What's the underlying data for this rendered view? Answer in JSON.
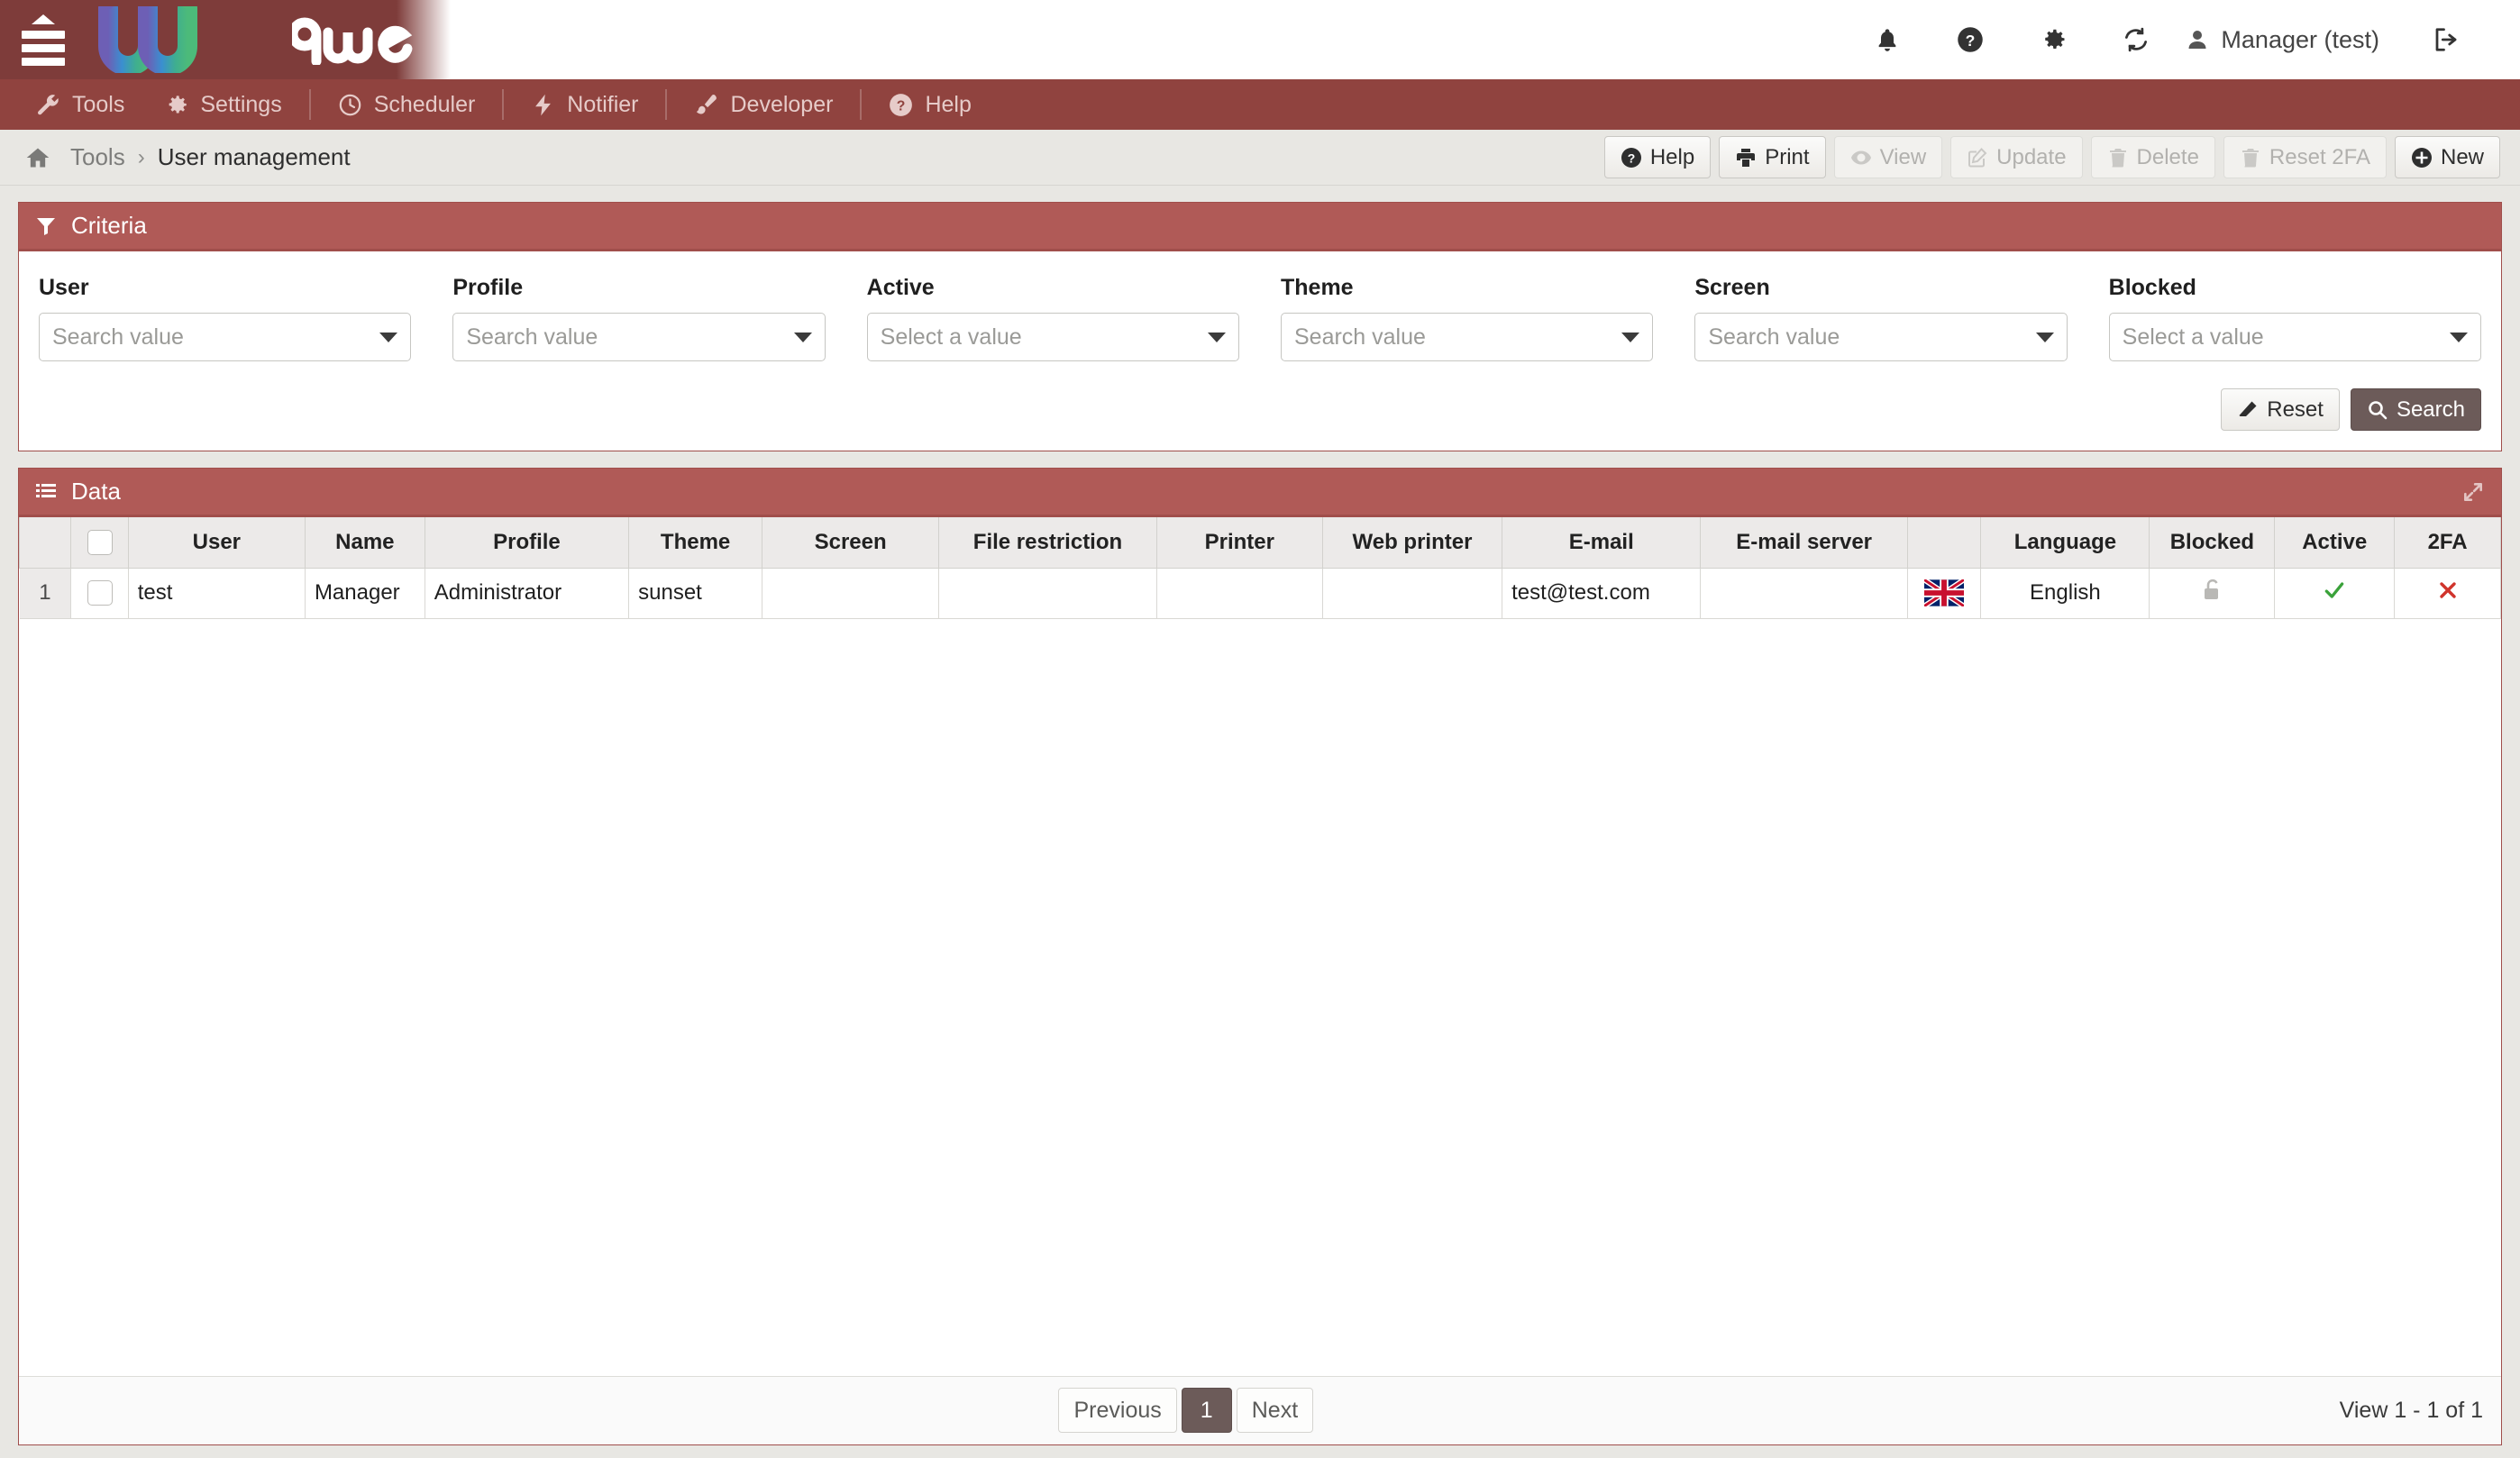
{
  "brand": {
    "name": "awe",
    "logo_mark": "W"
  },
  "topbar": {
    "menu_toggle": "menu-toggle",
    "icons": [
      "bell-icon",
      "question-circle-icon",
      "gear-icon",
      "refresh-icon"
    ],
    "user_label": "Manager (test)",
    "logout": "logout-icon"
  },
  "menubar": {
    "items": [
      {
        "label": "Tools",
        "icon": "wrench-icon"
      },
      {
        "label": "Settings",
        "icon": "gear-icon"
      },
      {
        "label": "Scheduler",
        "icon": "clock-icon"
      },
      {
        "label": "Notifier",
        "icon": "bolt-icon"
      },
      {
        "label": "Developer",
        "icon": "paintbrush-icon"
      },
      {
        "label": "Help",
        "icon": "question-circle-icon"
      }
    ]
  },
  "breadcrumb": {
    "home_icon": "home-icon",
    "parent": "Tools",
    "separator": "›",
    "current": "User management"
  },
  "actions": [
    {
      "label": "Help",
      "icon": "question-circle-icon",
      "disabled": false
    },
    {
      "label": "Print",
      "icon": "printer-icon",
      "disabled": false
    },
    {
      "label": "View",
      "icon": "eye-icon",
      "disabled": true
    },
    {
      "label": "Update",
      "icon": "pencil-square-icon",
      "disabled": true
    },
    {
      "label": "Delete",
      "icon": "trash-icon",
      "disabled": true
    },
    {
      "label": "Reset 2FA",
      "icon": "trash-icon",
      "disabled": true
    },
    {
      "label": "New",
      "icon": "plus-circle-icon",
      "disabled": false
    }
  ],
  "criteria": {
    "title": "Criteria",
    "icon": "filter-icon",
    "fields": [
      {
        "label": "User",
        "placeholder": "Search value"
      },
      {
        "label": "Profile",
        "placeholder": "Search value"
      },
      {
        "label": "Active",
        "placeholder": "Select a value"
      },
      {
        "label": "Theme",
        "placeholder": "Search value"
      },
      {
        "label": "Screen",
        "placeholder": "Search value"
      },
      {
        "label": "Blocked",
        "placeholder": "Select a value"
      }
    ],
    "reset_label": "Reset",
    "reset_icon": "eraser-icon",
    "search_label": "Search",
    "search_icon": "magnifier-icon"
  },
  "data_panel": {
    "title": "Data",
    "icon": "list-icon",
    "expand_icon": "expand-arrows-icon",
    "columns": [
      "",
      "",
      "User",
      "Name",
      "Profile",
      "Theme",
      "Screen",
      "File restriction",
      "Printer",
      "Web printer",
      "E-mail",
      "E-mail server",
      "",
      "Language",
      "Blocked",
      "Active",
      "2FA"
    ],
    "rows": [
      {
        "num": "1",
        "user": "test",
        "name": "Manager",
        "profile": "Administrator",
        "theme": "sunset",
        "screen": "",
        "file_restriction": "",
        "printer": "",
        "web_printer": "",
        "email": "test@test.com",
        "email_server": "",
        "flag": "uk-flag-icon",
        "language": "English",
        "blocked": "unlock-icon",
        "active": "check-icon",
        "twofa": "cross-icon"
      }
    ],
    "pagination": {
      "previous": "Previous",
      "pages": [
        "1"
      ],
      "current_page": "1",
      "next": "Next",
      "view_count": "View 1 - 1 of 1"
    }
  },
  "colors": {
    "topbar": "#7e3c3a",
    "menubar": "#90433f",
    "panel_header": "#b05a57",
    "panel_border": "#a04e4b",
    "page_bg": "#e8e7e3",
    "primary_button": "#6c5b59",
    "active_green": "#3aa23a",
    "inactive_red": "#d0342c"
  }
}
